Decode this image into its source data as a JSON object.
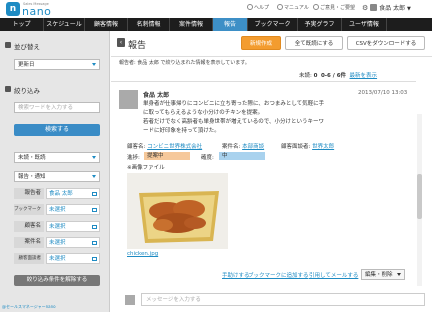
{
  "logo": {
    "tagline": "Sales Message",
    "name": "nano"
  },
  "util": {
    "help": "ヘルプ",
    "manual": "マニュアル",
    "feedback": "ご意見・ご要望"
  },
  "user": {
    "name": "食品 太郎"
  },
  "nav": [
    "トップ",
    "スケジュール",
    "顧客情報",
    "名刺情報",
    "案件情報",
    "報告",
    "ブックマーク",
    "予実グラフ",
    "ユーザ情報"
  ],
  "sidebar": {
    "sort_heading": "並び替え",
    "sort_value": "更新日",
    "filter_heading": "絞り込み",
    "keyword_placeholder": "検索ワードを入力する",
    "search_label": "検索する",
    "status_value": "未読・既読",
    "type_value": "報告・通知",
    "rows": [
      {
        "label": "報告者",
        "value": "食品 太郎"
      },
      {
        "label": "ブックマーク",
        "value": "未選択"
      },
      {
        "label": "顧客名",
        "value": "未選択"
      },
      {
        "label": "案件名",
        "value": "未選択"
      },
      {
        "label": "顧客面談者",
        "value": "未選択"
      }
    ],
    "clear_label": "絞り込み条件を解除する",
    "footer": "@セールスマネージャーnano"
  },
  "main": {
    "title": "報告",
    "new_label": "新規作成",
    "read_all_label": "全て既読にする",
    "csv_label": "CSVをダウンロードする",
    "notice": "報告者: 食品 太郎 で絞り込まれた情報を表示しています。",
    "unread_label": "未読:",
    "unread_count": "0",
    "range": "0-6 / 6件",
    "latest_link": "最新を表示"
  },
  "post": {
    "author": "食品 太郎",
    "date": "2013/07/10 13:03",
    "body": [
      "単身者が仕事帰りにコンビニに立ち寄った際に、おつまみとして気軽に手",
      "に取ってもらえるような小分けのチキンを提案。",
      "若者だけでなく高齢者も単身世帯が増えているので、小分けというキーワ",
      "ードに好印象を持って頂けた。"
    ],
    "customer_label": "顧客名:",
    "customer_value": "コンビニ世界株式会社",
    "project_label": "案件名:",
    "project_value": "本部商談",
    "contact_label": "顧客面談者:",
    "contact_value": "世界太郎",
    "progress_label": "進捗:",
    "progress_value": "提案中",
    "certainty_label": "確度:",
    "certainty_value": "中",
    "image_label": "※画像ファイル",
    "image_link": "chicken.jpg",
    "like_link": "手助けする",
    "bookmark_link": "ブックマークに追加する",
    "quote_link": "引用してメールする",
    "edit_label": "編集・削除",
    "message_placeholder": "メッセージを入力する"
  }
}
